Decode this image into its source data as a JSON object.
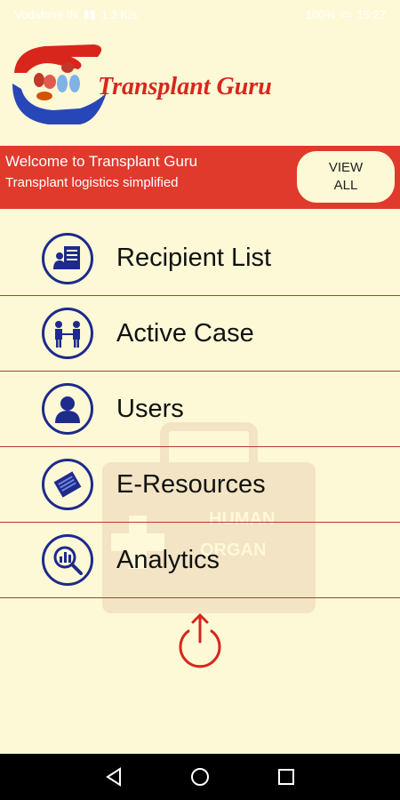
{
  "status_bar": {
    "carrier": "Vodafone IN",
    "speed": "1.3 K/s",
    "battery": "100%",
    "time": "15:27"
  },
  "header": {
    "title": "Transplant Guru"
  },
  "banner": {
    "title": "Welcome to Transplant Guru",
    "subtitle": "Transplant logistics simplified",
    "view_all_label": "VIEW\nALL"
  },
  "menu": {
    "items": [
      {
        "label": "Recipient List",
        "icon": "recipient-list-icon"
      },
      {
        "label": "Active Case",
        "icon": "active-case-icon"
      },
      {
        "label": "Users",
        "icon": "user-icon"
      },
      {
        "label": "E-Resources",
        "icon": "book-icon"
      },
      {
        "label": "Analytics",
        "icon": "analytics-icon"
      }
    ]
  },
  "watermark": {
    "line1": "HUMAN",
    "line2": "ORGAN"
  },
  "colors": {
    "accent_red": "#e03a2c",
    "icon_blue": "#1e2a8c",
    "background": "#fdf9d6"
  }
}
